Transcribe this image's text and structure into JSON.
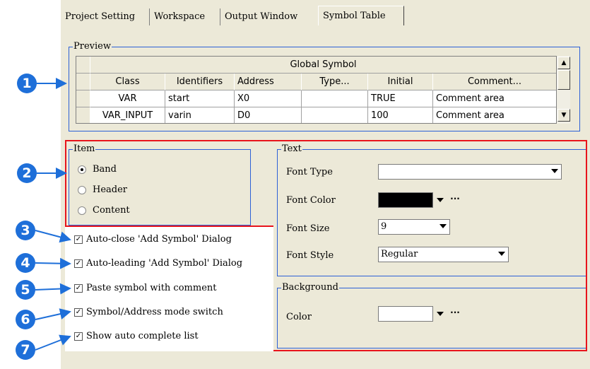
{
  "tabs": [
    "Project Setting",
    "Workspace",
    "Output Window",
    "Symbol Table"
  ],
  "preview": {
    "label": "Preview",
    "table_title": "Global Symbol",
    "columns": [
      "Class",
      "Identifiers",
      "Address",
      "Type...",
      "Initial",
      "Comment..."
    ],
    "rows": [
      [
        "VAR",
        "start",
        "X0",
        "",
        "TRUE",
        "Comment area"
      ],
      [
        "VAR_INPUT",
        "varin",
        "D0",
        "",
        "100",
        "Comment area"
      ]
    ]
  },
  "item": {
    "label": "Item",
    "options": [
      {
        "label": "Band",
        "selected": true
      },
      {
        "label": "Header",
        "selected": false
      },
      {
        "label": "Content",
        "selected": false
      }
    ]
  },
  "checkboxes": [
    {
      "label": "Auto-close 'Add Symbol' Dialog",
      "checked": true
    },
    {
      "label": "Auto-leading 'Add Symbol' Dialog",
      "checked": true
    },
    {
      "label": "Paste symbol with comment",
      "checked": true
    },
    {
      "label": "Symbol/Address mode switch",
      "checked": true
    },
    {
      "label": "Show auto complete list",
      "checked": true
    }
  ],
  "text": {
    "label": "Text",
    "font_type_label": "Font Type",
    "font_type_value": "",
    "font_color_label": "Font Color",
    "font_color_value": "#000000",
    "font_size_label": "Font Size",
    "font_size_value": "9",
    "font_style_label": "Font Style",
    "font_style_value": "Regular"
  },
  "background": {
    "label": "Background",
    "color_label": "Color",
    "color_value": "#ffffff"
  },
  "ellipsis": "···",
  "callouts": [
    "1",
    "2",
    "3",
    "4",
    "5",
    "6",
    "7"
  ],
  "colors": {
    "callout": "#1e6fd9",
    "highlight": "#e8141c",
    "group_border": "#2c60d6"
  }
}
